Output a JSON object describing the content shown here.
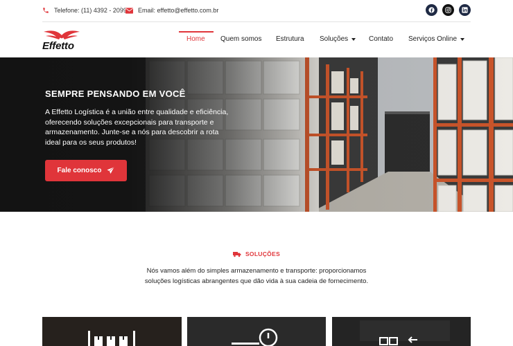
{
  "topbar": {
    "phone": "Telefone: (11) 4392 - 2099",
    "separator": "|",
    "email": "Email: effetto@effetto.com.br",
    "socials": [
      "facebook-icon",
      "instagram-icon",
      "linkedin-icon"
    ]
  },
  "logo": {
    "text": "Effetto"
  },
  "nav": {
    "items": [
      {
        "label": "Home",
        "active": true
      },
      {
        "label": "Quem somos"
      },
      {
        "label": "Estrutura"
      },
      {
        "label": "Soluções",
        "dropdown": true
      },
      {
        "label": "Contato"
      },
      {
        "label": "Serviços Online",
        "dropdown": true
      }
    ]
  },
  "hero": {
    "title": "SEMPRE PENSANDO EM VOCÊ",
    "text": "A Effetto Logística é a união entre qualidade e eficiência, oferecendo soluções excepcionais para transporte e armazenamento. Junte-se a nós para descobrir a rota ideal para os seus produtos!",
    "cta_label": "Fale conosco"
  },
  "solutions": {
    "label": "SOLUÇÕES",
    "text": "Nós vamos além do simples armazenamento e transporte: proporcionamos soluções logísticas abrangentes que dão vida à sua cadeia de fornecimento."
  },
  "colors": {
    "accent": "#e0353a",
    "dark": "#1a1a1a"
  }
}
